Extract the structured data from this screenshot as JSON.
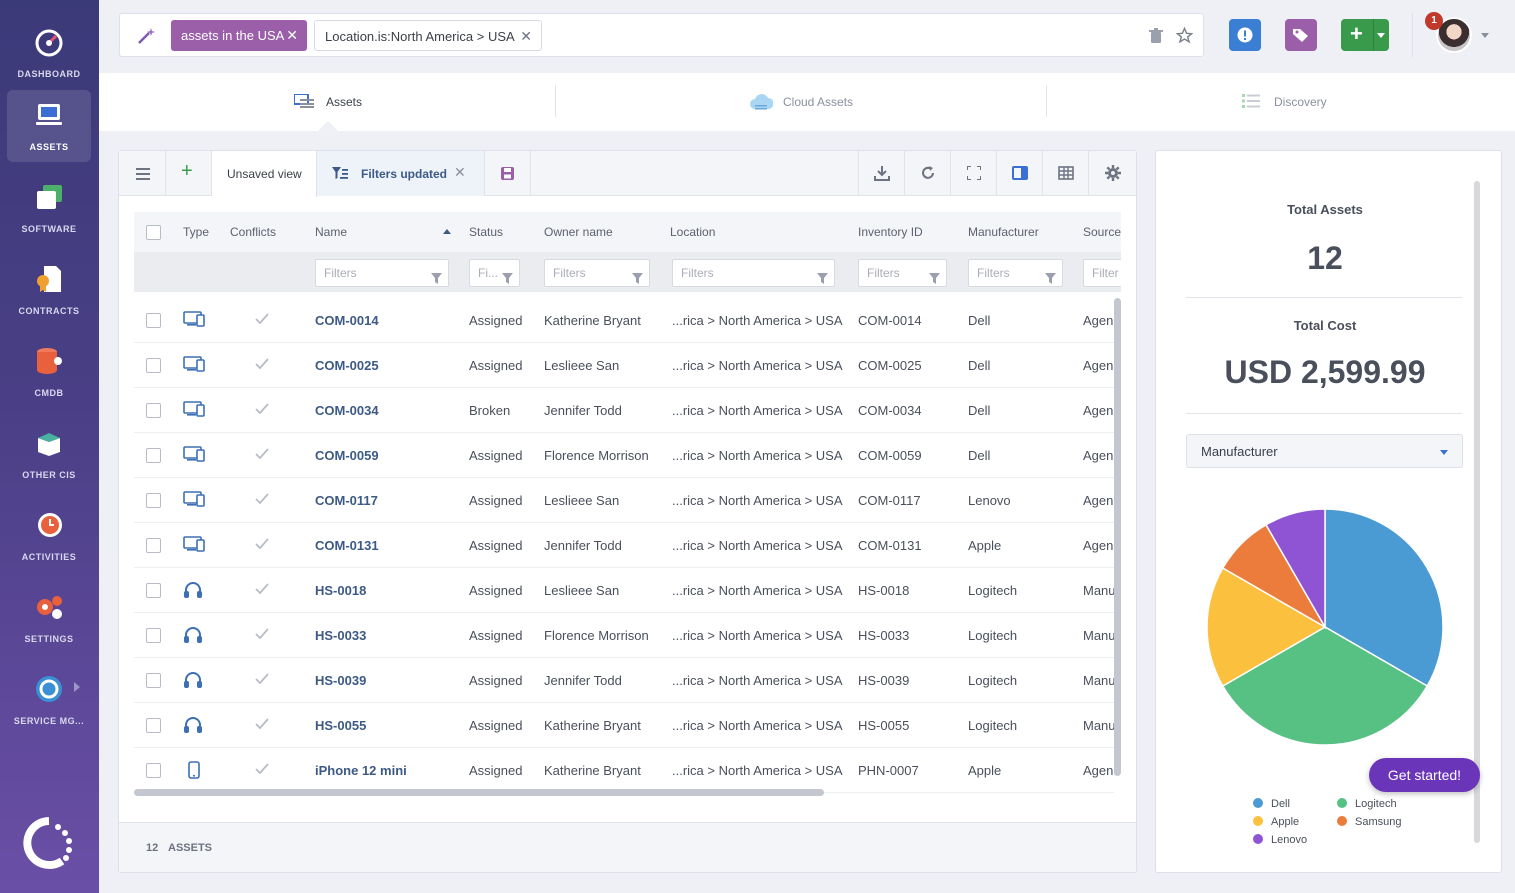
{
  "sidebar": {
    "items": [
      {
        "label": "DASHBOARD",
        "icon": "gauge-icon"
      },
      {
        "label": "ASSETS",
        "icon": "laptop-icon",
        "active": true
      },
      {
        "label": "SOFTWARE",
        "icon": "windows-icon"
      },
      {
        "label": "CONTRACTS",
        "icon": "contract-icon"
      },
      {
        "label": "CMDB",
        "icon": "database-icon"
      },
      {
        "label": "OTHER CIS",
        "icon": "box-icon"
      },
      {
        "label": "ACTIVITIES",
        "icon": "clock-icon"
      },
      {
        "label": "SETTINGS",
        "icon": "gears-icon"
      },
      {
        "label": "SERVICE MG...",
        "icon": "service-icon"
      }
    ]
  },
  "search": {
    "chip1": "assets in the USA",
    "chip2": "Location.is:North America > USA"
  },
  "topbar": {
    "notification_count": "1"
  },
  "view_tabs": [
    "Assets",
    "Cloud Assets",
    "Discovery"
  ],
  "toolbar": {
    "view_label": "Unsaved view",
    "filters_label": "Filters updated"
  },
  "table": {
    "columns": [
      "Type",
      "Conflicts",
      "Name",
      "Status",
      "Owner name",
      "Location",
      "Inventory ID",
      "Manufacturer",
      "Source"
    ],
    "filter_placeholders": [
      "Filters",
      "Fi...",
      "Filters",
      "Filters",
      "Filters",
      "Filters",
      "Filter"
    ],
    "rows": [
      {
        "type": "computer",
        "name": "COM-0014",
        "status": "Assigned",
        "owner": "Katherine Bryant",
        "location": "...rica > North America > USA",
        "inventory_id": "COM-0014",
        "manufacturer": "Dell",
        "source": "Agen"
      },
      {
        "type": "computer",
        "name": "COM-0025",
        "status": "Assigned",
        "owner": "Leslieee San",
        "location": "...rica > North America > USA",
        "inventory_id": "COM-0025",
        "manufacturer": "Dell",
        "source": "Agen"
      },
      {
        "type": "computer",
        "name": "COM-0034",
        "status": "Broken",
        "owner": "Jennifer Todd",
        "location": "...rica > North America > USA",
        "inventory_id": "COM-0034",
        "manufacturer": "Dell",
        "source": "Agen"
      },
      {
        "type": "computer",
        "name": "COM-0059",
        "status": "Assigned",
        "owner": "Florence Morrison",
        "location": "...rica > North America > USA",
        "inventory_id": "COM-0059",
        "manufacturer": "Dell",
        "source": "Agen"
      },
      {
        "type": "computer",
        "name": "COM-0117",
        "status": "Assigned",
        "owner": "Leslieee San",
        "location": "...rica > North America > USA",
        "inventory_id": "COM-0117",
        "manufacturer": "Lenovo",
        "source": "Agen"
      },
      {
        "type": "computer",
        "name": "COM-0131",
        "status": "Assigned",
        "owner": "Jennifer Todd",
        "location": "...rica > North America > USA",
        "inventory_id": "COM-0131",
        "manufacturer": "Apple",
        "source": "Agen"
      },
      {
        "type": "headset",
        "name": "HS-0018",
        "status": "Assigned",
        "owner": "Leslieee San",
        "location": "...rica > North America > USA",
        "inventory_id": "HS-0018",
        "manufacturer": "Logitech",
        "source": "Manu"
      },
      {
        "type": "headset",
        "name": "HS-0033",
        "status": "Assigned",
        "owner": "Florence Morrison",
        "location": "...rica > North America > USA",
        "inventory_id": "HS-0033",
        "manufacturer": "Logitech",
        "source": "Manu"
      },
      {
        "type": "headset",
        "name": "HS-0039",
        "status": "Assigned",
        "owner": "Jennifer Todd",
        "location": "...rica > North America > USA",
        "inventory_id": "HS-0039",
        "manufacturer": "Logitech",
        "source": "Manu"
      },
      {
        "type": "headset",
        "name": "HS-0055",
        "status": "Assigned",
        "owner": "Katherine Bryant",
        "location": "...rica > North America > USA",
        "inventory_id": "HS-0055",
        "manufacturer": "Logitech",
        "source": "Manu"
      },
      {
        "type": "phone",
        "name": "iPhone 12 mini",
        "status": "Assigned",
        "owner": "Katherine Bryant",
        "location": "...rica > North America > USA",
        "inventory_id": "PHN-0007",
        "manufacturer": "Apple",
        "source": "Agen"
      }
    ]
  },
  "footer": {
    "count": "12",
    "label": "ASSETS"
  },
  "summary": {
    "total_assets_label": "Total Assets",
    "total_assets": "12",
    "total_cost_label": "Total Cost",
    "total_cost": "USD 2,599.99",
    "group_by": "Manufacturer"
  },
  "chart_data": {
    "type": "pie",
    "categories": [
      "Dell",
      "Logitech",
      "Apple",
      "Samsung",
      "Lenovo"
    ],
    "values": [
      4,
      4,
      2,
      1,
      1
    ],
    "colors": [
      "#4a9bd4",
      "#57c083",
      "#fbc03e",
      "#ec7c3c",
      "#8e54d4"
    ]
  },
  "get_started": "Get started!"
}
